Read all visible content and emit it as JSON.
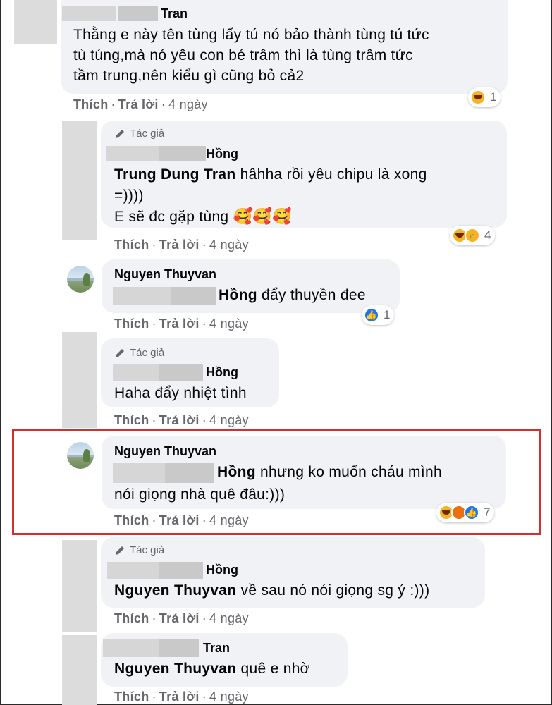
{
  "colors": {
    "highlight": "#d32f2f",
    "bubble": "#f0f2f5",
    "meta": "#65676b"
  },
  "comments": [
    {
      "name": "Tran",
      "lines": [
        "Thằng e này tên tùng lấy tú nó bảo thành tùng tú tức",
        "tù túng,mà nó yêu con bé trâm thì là tùng trâm tức",
        "tầm trung,nên kiểu gì cũng bỏ cả2"
      ],
      "like": "Thích",
      "reply": "Trả lời",
      "time": "4 ngày",
      "reaction_count": "1",
      "reactions": [
        "haha-icon"
      ]
    },
    {
      "author_badge": "Tác giả",
      "name": "Hồng",
      "mention": "Trung Dung Tran",
      "line1_rest": " hâhha rồi yêu chipu là xong",
      "line2": "=))))",
      "line3": "E sẽ đc gặp tùng",
      "like": "Thích",
      "reply": "Trả lời",
      "time": "4 ngày",
      "reaction_count": "4",
      "reactions": [
        "haha-icon",
        "wow-icon"
      ]
    },
    {
      "name": "Nguyen Thuyvan",
      "mention": "Hồng",
      "line1_rest": " đẩy thuyền đee",
      "like": "Thích",
      "reply": "Trả lời",
      "time": "4 ngày",
      "reaction_count": "1",
      "reactions": [
        "like-icon"
      ]
    },
    {
      "author_badge": "Tác giả",
      "name": "Hồng",
      "line1": "Haha đẩy nhiệt tình",
      "like": "Thích",
      "reply": "Trả lời",
      "time": "4 ngày"
    },
    {
      "name": "Nguyen Thuyvan",
      "mention": "Hồng",
      "line1_rest": " nhưng ko muốn cháu mình",
      "line2": "nói giọng nhà quê đâu:)))",
      "like": "Thích",
      "reply": "Trả lời",
      "time": "4 ngày",
      "reaction_count": "7",
      "reactions": [
        "haha-icon",
        "angry-icon",
        "like-icon"
      ]
    },
    {
      "author_badge": "Tác giả",
      "name": "Hồng",
      "mention": "Nguyen Thuyvan",
      "line1_rest": " về sau nó nói giọng sg ý :)))",
      "like": "Thích",
      "reply": "Trả lời",
      "time": "4 ngày"
    },
    {
      "name": "Tran",
      "mention": "Nguyen Thuyvan",
      "line1_rest": " quê e nhờ",
      "like": "Thích",
      "reply": "Trả lời",
      "time": "4 ngày"
    }
  ]
}
